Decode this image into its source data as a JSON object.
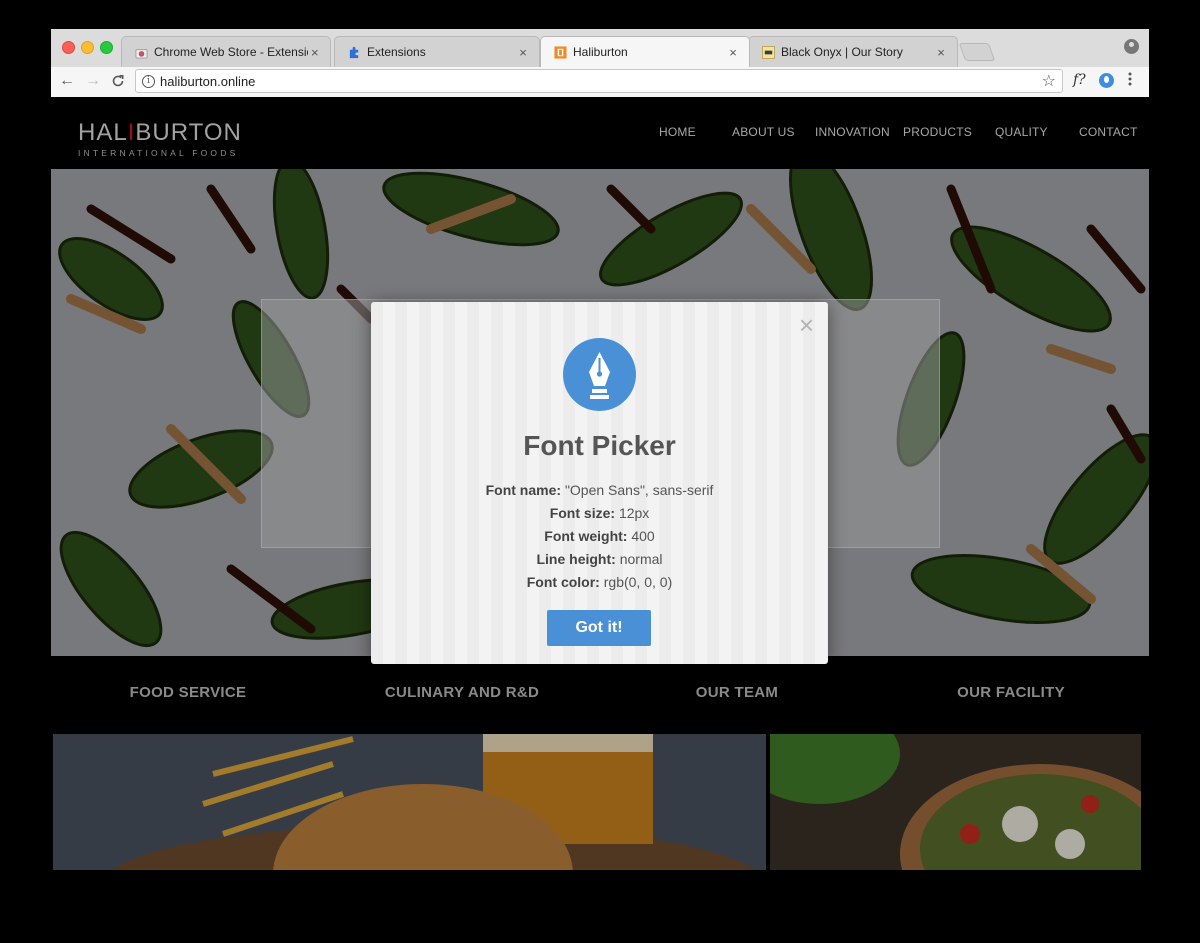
{
  "browser": {
    "tabs": [
      {
        "title": "Chrome Web Store - Extensions",
        "icon": "chrome-web-store-icon"
      },
      {
        "title": "Extensions",
        "icon": "puzzle-icon"
      },
      {
        "title": "Haliburton",
        "icon": "haliburton-favicon"
      },
      {
        "title": "Black Onyx | Our Story",
        "icon": "black-onyx-favicon"
      }
    ],
    "active_tab": 2,
    "tab_close_glyph": "×",
    "url": "haliburton.online",
    "info_glyph": "i",
    "star_glyph": "☆",
    "font_ext_label": "f?",
    "back_glyph": "←",
    "forward_glyph": "→",
    "reload_glyph": "C"
  },
  "site": {
    "logo": {
      "left": "HAL",
      "accent": "I",
      "right": "BURTON",
      "tagline": "INTERNATIONAL FOODS"
    },
    "nav": [
      "HOME",
      "ABOUT US",
      "INNOVATION",
      "PRODUCTS",
      "QUALITY",
      "CONTACT"
    ],
    "sections": [
      "FOOD SERVICE",
      "CULINARY AND R&D",
      "OUR TEAM",
      "OUR FACILITY"
    ]
  },
  "modal": {
    "close_glyph": "×",
    "title": "Font Picker",
    "lines": [
      {
        "label": "Font name:",
        "value": "\"Open Sans\", sans-serif"
      },
      {
        "label": "Font size:",
        "value": "12px"
      },
      {
        "label": "Font weight:",
        "value": "400"
      },
      {
        "label": "Line height:",
        "value": "normal"
      },
      {
        "label": "Font color:",
        "value": "rgb(0, 0, 0)"
      }
    ],
    "button": "Got it!",
    "accent_color": "#4a90d6"
  }
}
